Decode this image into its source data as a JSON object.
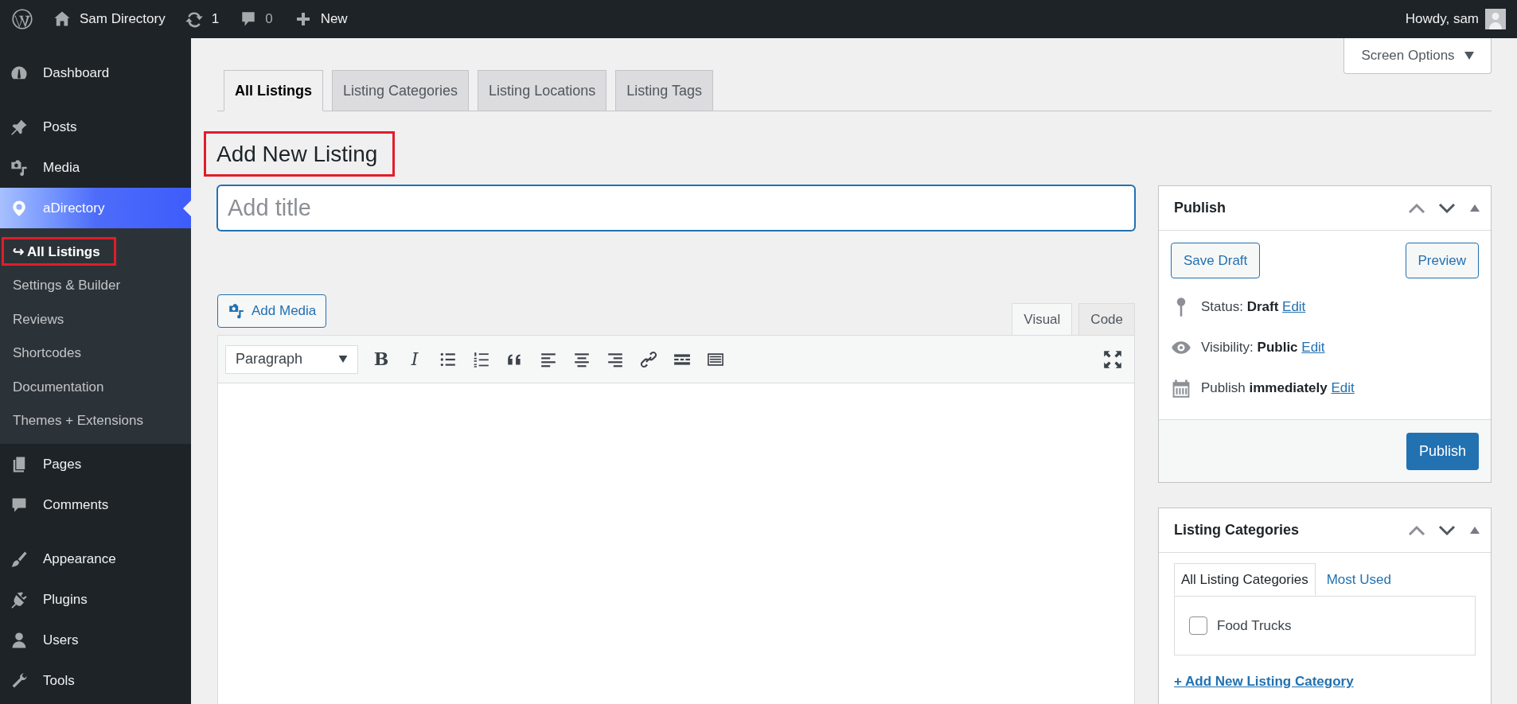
{
  "top_bar": {
    "site_name": "Sam Directory",
    "updates_count": "1",
    "comments_count": "0",
    "new_label": "New",
    "greeting": "Howdy, sam"
  },
  "sidebar": {
    "groups": [
      [
        {
          "label": "Dashboard",
          "current": false
        }
      ],
      [
        {
          "label": "Posts",
          "current": false
        },
        {
          "label": "Media",
          "current": false
        },
        {
          "label": "aDirectory",
          "current": true,
          "children": [
            {
              "label": "↪ All Listings",
              "selected": true,
              "annotated": true
            },
            {
              "label": "Settings & Builder",
              "selected": false,
              "annotated": false
            },
            {
              "label": "Reviews",
              "selected": false,
              "annotated": false
            },
            {
              "label": "Shortcodes",
              "selected": false,
              "annotated": false
            },
            {
              "label": "Documentation",
              "selected": false,
              "annotated": false
            },
            {
              "label": "Themes + Extensions",
              "selected": false,
              "annotated": false
            }
          ]
        },
        {
          "label": "Pages",
          "current": false
        },
        {
          "label": "Comments",
          "current": false
        }
      ],
      [
        {
          "label": "Appearance",
          "current": false
        },
        {
          "label": "Plugins",
          "current": false
        },
        {
          "label": "Users",
          "current": false
        },
        {
          "label": "Tools",
          "current": false
        }
      ]
    ]
  },
  "screen_options": {
    "label": "Screen Options"
  },
  "tabs": [
    {
      "label": "All Listings",
      "selected": true
    },
    {
      "label": "Listing Categories",
      "selected": false
    },
    {
      "label": "Listing Locations",
      "selected": false
    },
    {
      "label": "Listing Tags",
      "selected": false
    }
  ],
  "heading": {
    "text": "Add New Listing",
    "annotated": true
  },
  "title_field": {
    "placeholder": "Add title"
  },
  "editor": {
    "add_media": "Add Media",
    "modes": [
      {
        "label": "Visual",
        "selected": true
      },
      {
        "label": "Code",
        "selected": false
      }
    ],
    "format": "Paragraph",
    "toolbar": [
      {
        "kind": "text",
        "label": "B"
      },
      {
        "kind": "text",
        "label": "I"
      },
      {
        "kind": "icon"
      },
      {
        "kind": "icon"
      },
      {
        "kind": "icon"
      },
      {
        "kind": "icon"
      },
      {
        "kind": "icon"
      },
      {
        "kind": "icon"
      },
      {
        "kind": "icon"
      },
      {
        "kind": "icon"
      },
      {
        "kind": "icon"
      }
    ]
  },
  "publish_box": {
    "title": "Publish",
    "save_draft": "Save Draft",
    "preview": "Preview",
    "rows": [
      {
        "text": "Status: **Draft**",
        "link": "Edit"
      },
      {
        "text": "Visibility: **Public**",
        "link": "Edit"
      },
      {
        "text": "Publish **immediately**",
        "link": "Edit"
      }
    ],
    "publish_button": "Publish"
  },
  "categories_box": {
    "title": "Listing Categories",
    "tabs": [
      {
        "label": "All Listing Categories",
        "selected": true
      },
      {
        "label": "Most Used",
        "selected": false
      }
    ],
    "items": [
      {
        "label": "Food Trucks",
        "checked": false
      }
    ],
    "add_link": "+ Add New Listing Category"
  }
}
